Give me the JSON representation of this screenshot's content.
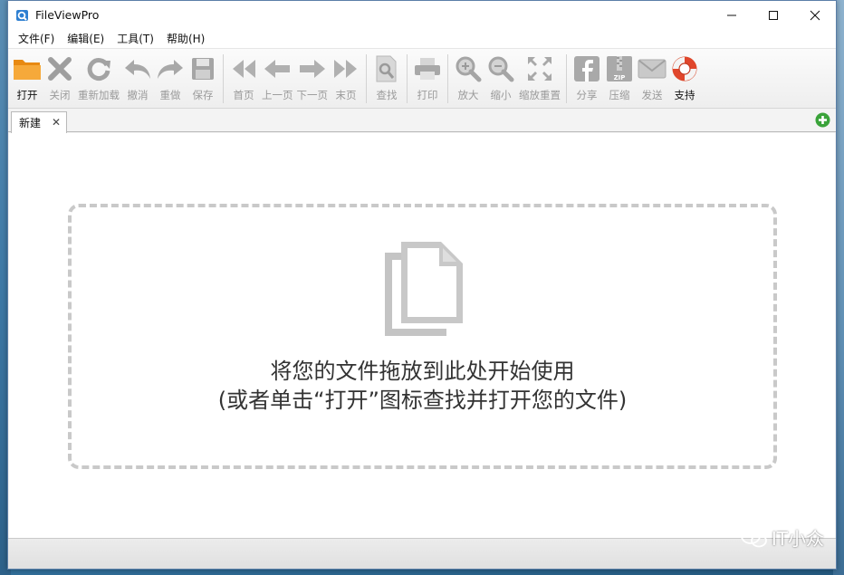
{
  "window": {
    "title": "FileViewPro",
    "controls": {
      "minimize": "—",
      "maximize": "☐",
      "close": "✕"
    }
  },
  "menu": [
    {
      "label": "文件(F)"
    },
    {
      "label": "编辑(E)"
    },
    {
      "label": "工具(T)"
    },
    {
      "label": "帮助(H)"
    }
  ],
  "toolbar": {
    "open": {
      "label": "打开",
      "icon": "folder-icon",
      "enabled": true
    },
    "close": {
      "label": "关闭",
      "icon": "close-x-icon",
      "enabled": false
    },
    "reload": {
      "label": "重新加载",
      "icon": "reload-icon",
      "enabled": false
    },
    "undo": {
      "label": "撤消",
      "icon": "undo-icon",
      "enabled": false
    },
    "redo": {
      "label": "重做",
      "icon": "redo-icon",
      "enabled": false
    },
    "save": {
      "label": "保存",
      "icon": "save-icon",
      "enabled": false
    },
    "first": {
      "label": "首页",
      "icon": "first-page-icon",
      "enabled": false
    },
    "prev": {
      "label": "上一页",
      "icon": "prev-page-icon",
      "enabled": false
    },
    "next": {
      "label": "下一页",
      "icon": "next-page-icon",
      "enabled": false
    },
    "last": {
      "label": "末页",
      "icon": "last-page-icon",
      "enabled": false
    },
    "find": {
      "label": "查找",
      "icon": "find-icon",
      "enabled": false
    },
    "print": {
      "label": "打印",
      "icon": "printer-icon",
      "enabled": false
    },
    "zoom_in": {
      "label": "放大",
      "icon": "zoom-in-icon",
      "enabled": false
    },
    "zoom_out": {
      "label": "缩小",
      "icon": "zoom-out-icon",
      "enabled": false
    },
    "zoom_reset": {
      "label": "缩放重置",
      "icon": "zoom-reset-icon",
      "enabled": false
    },
    "share": {
      "label": "分享",
      "icon": "facebook-icon",
      "enabled": false
    },
    "compress": {
      "label": "压缩",
      "icon": "zip-icon",
      "enabled": false
    },
    "send": {
      "label": "发送",
      "icon": "envelope-icon",
      "enabled": false
    },
    "support": {
      "label": "支持",
      "icon": "lifebuoy-icon",
      "enabled": true
    }
  },
  "tabs": [
    {
      "label": "新建",
      "close": "✕",
      "active": true
    }
  ],
  "dropzone": {
    "line1": "将您的文件拖放到此处开始使用",
    "line2": "(或者单击“打开”图标查找并打开您的文件)"
  },
  "watermark": {
    "text": "IT小众"
  },
  "colors": {
    "accent_orange": "#f29b1e",
    "support_red": "#e0462c",
    "add_green": "#3aa33a",
    "disabled_gray": "#a9a9a9"
  }
}
